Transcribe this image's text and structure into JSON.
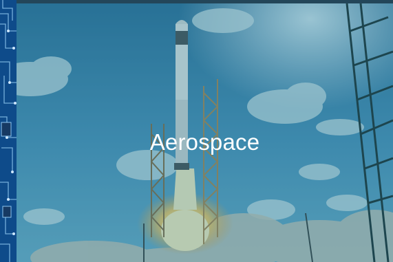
{
  "tile": {
    "title": "Aerospace",
    "background_icon": "rocket-launch-photo",
    "overlay_color": "#1f7588"
  },
  "neighbor_tile": {
    "background_icon": "circuit-board-photo",
    "color": "#0d3f78"
  }
}
